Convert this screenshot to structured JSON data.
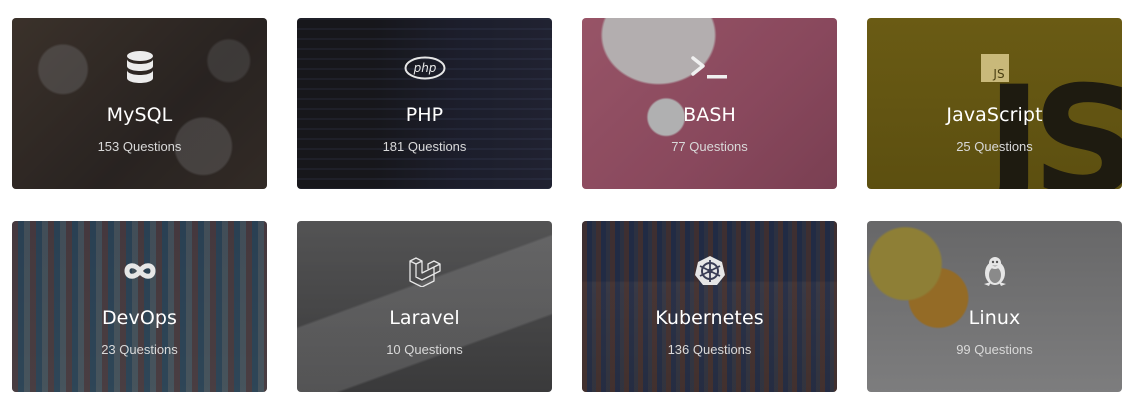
{
  "cards": [
    {
      "title": "MySQL",
      "count": "153 Questions",
      "icon": "database-icon"
    },
    {
      "title": "PHP",
      "count": "181 Questions",
      "icon": "php-logo-icon"
    },
    {
      "title": "BASH",
      "count": "77 Questions",
      "icon": "terminal-icon"
    },
    {
      "title": "JavaScript",
      "count": "25 Questions",
      "icon": "js-logo-icon"
    },
    {
      "title": "DevOps",
      "count": "23 Questions",
      "icon": "infinity-icon"
    },
    {
      "title": "Laravel",
      "count": "10 Questions",
      "icon": "laravel-logo-icon"
    },
    {
      "title": "Kubernetes",
      "count": "136 Questions",
      "icon": "helm-wheel-icon"
    },
    {
      "title": "Linux",
      "count": "99 Questions",
      "icon": "penguin-icon"
    }
  ],
  "logo_text": {
    "php": "php",
    "js": "JS"
  }
}
